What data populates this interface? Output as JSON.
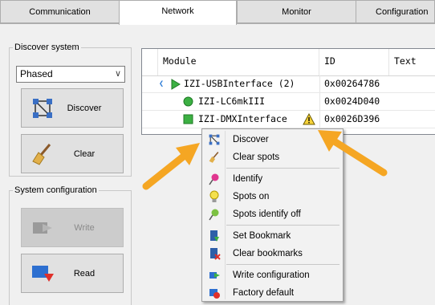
{
  "tabs": [
    "Communication",
    "Network",
    "Monitor",
    "Configuration"
  ],
  "discover_group": {
    "title": "Discover system",
    "combo_value": "Phased",
    "discover_label": "Discover",
    "clear_label": "Clear"
  },
  "system_group": {
    "title": "System configuration",
    "write_label": "Write",
    "read_label": "Read"
  },
  "tree": {
    "columns": [
      "Module",
      "ID",
      "Text"
    ],
    "rows": [
      {
        "name": "IZI-USBInterface (2)",
        "id": "0x00264786"
      },
      {
        "name": "IZI-LC6mkIII",
        "id": "0x0024D040"
      },
      {
        "name": "IZI-DMXInterface",
        "id": "0x0026D396"
      }
    ]
  },
  "menu": {
    "items": [
      "Discover",
      "Clear spots",
      "Identify",
      "Spots on",
      "Spots identify off",
      "Set Bookmark",
      "Clear bookmarks",
      "Write configuration",
      "Factory default"
    ]
  },
  "colors": {
    "arrow": "#f5a623",
    "accent_green": "#3cb043",
    "expand_blue": "#2b7bd6"
  }
}
